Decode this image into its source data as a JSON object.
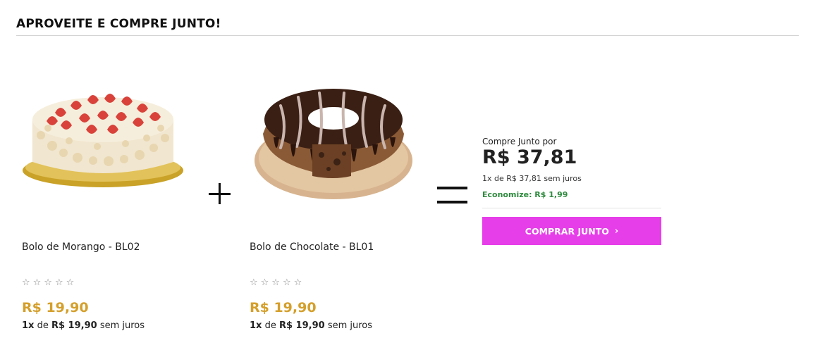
{
  "section": {
    "title": "APROVEITE E COMPRE JUNTO!"
  },
  "products": [
    {
      "name": "Bolo de Morango - BL02",
      "rating_stars": "☆☆☆☆☆",
      "price": "R$ 19,90",
      "installments": {
        "count": "1x",
        "of": "de",
        "value": "R$ 19,90",
        "suffix": "sem juros"
      }
    },
    {
      "name": "Bolo de Chocolate - BL01",
      "rating_stars": "☆☆☆☆☆",
      "price": "R$ 19,90",
      "installments": {
        "count": "1x",
        "of": "de",
        "value": "R$ 19,90",
        "suffix": "sem juros"
      }
    }
  ],
  "bundle": {
    "label": "Compre Junto por",
    "price": "R$ 37,81",
    "installments": "1x de R$ 37,81 sem juros",
    "savings": "Economize: R$ 1,99",
    "button_label": "COMPRAR JUNTO",
    "button_icon": "chevron-right-icon"
  },
  "colors": {
    "price_accent": "#d49f2b",
    "savings_green": "#2e8b3e",
    "button_bg": "#e63ee8"
  }
}
